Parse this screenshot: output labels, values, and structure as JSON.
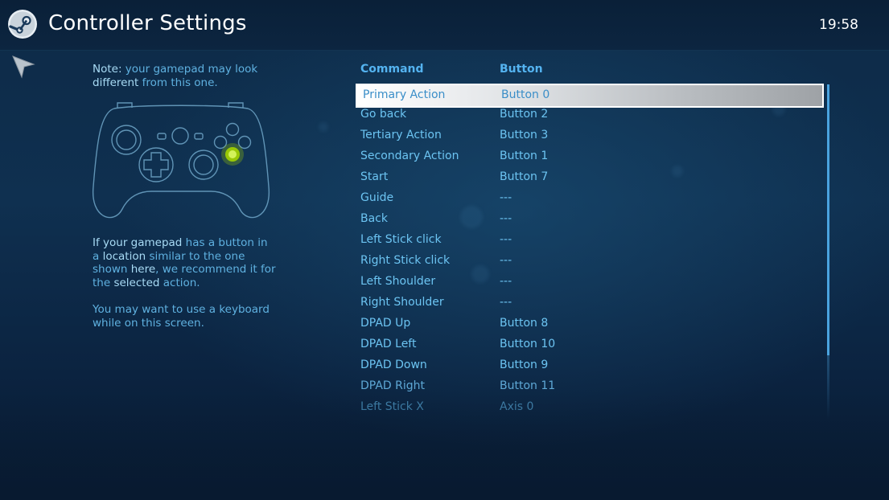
{
  "header": {
    "title": "Controller Settings",
    "clock": "19:58"
  },
  "icons": {
    "logo": "steam-logo-icon",
    "cursor": "pointer-arrow-icon",
    "gamepad": "gamepad-icon"
  },
  "left_panel": {
    "note_prefix": "Note:",
    "note_mid": " your gamepad may look ",
    "note_strong2": "different",
    "note_rest": " from this one.",
    "hint_strong1": "If your gamepad",
    "hint_mid1": " has a button in a ",
    "hint_strong2": "location",
    "hint_mid2": " similar to the one shown ",
    "hint_strong3": "here",
    "hint_mid3": ", we recommend it for the ",
    "hint_strong4": "selected",
    "hint_rest": " action.",
    "keyboard_hint": "You may want to use a keyboard while on this screen."
  },
  "table": {
    "headers": {
      "command": "Command",
      "button": "Button"
    },
    "rows": [
      {
        "command": "Primary Action",
        "button": "Button 0"
      },
      {
        "command": "Go back",
        "button": "Button 2"
      },
      {
        "command": "Tertiary Action",
        "button": "Button 3"
      },
      {
        "command": "Secondary Action",
        "button": "Button 1"
      },
      {
        "command": "Start",
        "button": "Button 7"
      },
      {
        "command": "Guide",
        "button": "---"
      },
      {
        "command": "Back",
        "button": "---"
      },
      {
        "command": "Left Stick click",
        "button": "---"
      },
      {
        "command": "Right Stick click",
        "button": "---"
      },
      {
        "command": "Left Shoulder",
        "button": "---"
      },
      {
        "command": "Right Shoulder",
        "button": "---"
      },
      {
        "command": "DPAD Up",
        "button": "Button 8"
      },
      {
        "command": "DPAD Left",
        "button": "Button 10"
      },
      {
        "command": "DPAD Down",
        "button": "Button 9"
      },
      {
        "command": "DPAD Right",
        "button": "Button 11"
      },
      {
        "command": "Left Stick X",
        "button": "Axis 0"
      }
    ]
  },
  "colors": {
    "accent": "#54b3f0",
    "highlight": "#a4d400"
  }
}
